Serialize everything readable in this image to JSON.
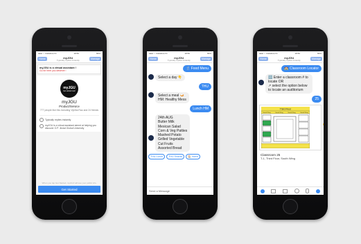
{
  "phones": {
    "one": {
      "status": {
        "carrier": "●●●○○ Vodafone IN",
        "time": "18:50",
        "battery": "84%"
      },
      "nav": {
        "back": "Home",
        "title": "myJGU",
        "subtitle": "Typically replies instantly",
        "action": "Manage"
      },
      "banner": {
        "title": "myJGU is a virtual assistant !",
        "link": "Go for here you deserve !"
      },
      "profile": {
        "logo_text": "myJGU",
        "logo_tag": "Get started now!",
        "name": "myJGU",
        "category": "Product/Service",
        "likes": "777 people like this including Vijetha Rao and 24 friends",
        "replies": "Typically replies instantly",
        "about": "myJGU is a virtual assistant aimed at helping you discover O.P. Jindal Global University"
      },
      "footer_note": "When you tap Get Started, myJGU will see your public info.",
      "cta": "Get Started"
    },
    "two": {
      "status": {
        "carrier": "●●●○○ Vodafone IN",
        "time": "18:50",
        "battery": "84%"
      },
      "nav": {
        "back": "Home",
        "title": "myJGU",
        "subtitle": "Typically replies instantly",
        "action": "Manage"
      },
      "messages": {
        "food_menu": "🍴 Food Menu",
        "select_day": "Select a day 👇",
        "thu": "THU",
        "select_meal": "Select a meal 🍛",
        "hm": "HM: Healthy Mess",
        "lunch": "Lunch HM",
        "menu": [
          "24th AUG",
          "Butter Milk",
          "Mexican Salad",
          "Corn & Veg Patties",
          "Mashed Potato",
          "Grilled Vegetable",
          "Cut Fruits",
          "Assorted Bread"
        ]
      },
      "quick_replies": [
        "THU Lunch",
        "THU Snacks",
        "🏠 Home"
      ],
      "composer": "Send a Message"
    },
    "three": {
      "status": {
        "carrier": "●●●○○ Vodafone IN",
        "time": "18:50",
        "battery": "84%"
      },
      "nav": {
        "back": "Home",
        "title": "myJGU",
        "subtitle": "Typically replies instantly",
        "action": "Manage"
      },
      "messages": {
        "locator": "🏫 Classroom Locator",
        "instruction": "🔢 Enter a classroom # to locate OR\n↗ select the option below to locate an auditorium",
        "number": "25",
        "classroom": "Classroom 25",
        "location": "T-1, Third Floor, South Wing"
      },
      "map": {
        "header": "Third Floor",
        "wings": [
          "South Wing",
          "South Wing",
          "South Wing",
          "South Wing"
        ]
      }
    }
  },
  "colors": {
    "messenger_blue": "#3b8bf1",
    "highlight_green": "#2fa84f",
    "floor_yellow": "#f4e24a"
  }
}
